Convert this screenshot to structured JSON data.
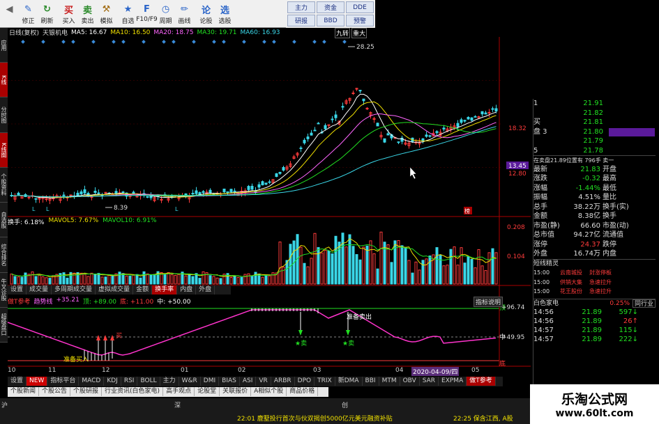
{
  "toolbar": {
    "buttons": [
      {
        "label": "",
        "icon": "back-icon"
      },
      {
        "label": "修正",
        "icon": "edit-icon"
      },
      {
        "label": "刷新",
        "icon": "refresh-icon"
      },
      {
        "label": "买入",
        "icon": "buy-icon"
      },
      {
        "label": "卖出",
        "icon": "sell-icon"
      },
      {
        "label": "模拟",
        "icon": "hammer-icon"
      },
      {
        "label": "自选",
        "icon": "star-icon"
      },
      {
        "label": "F10/F9",
        "icon": "f10-icon"
      },
      {
        "label": "周期",
        "icon": "clock-icon"
      },
      {
        "label": "画线",
        "icon": "pen-icon"
      },
      {
        "label": "论股",
        "icon": "chat-icon"
      },
      {
        "label": "选股",
        "icon": "filter-icon"
      }
    ],
    "quick": [
      "主力",
      "资金",
      "DDE",
      "研报",
      "BBD",
      "预警"
    ]
  },
  "left_tabs": [
    "应用",
    "K线",
    "分时图",
    "K线图",
    "个股资料",
    "自选股",
    "综合排名",
    "牛叉诊股",
    "超级盘口"
  ],
  "chart_header": {
    "title": "日线(复权)",
    "name": "天银机电",
    "ma": [
      {
        "label": "MA5: 16.67",
        "color": "#ffffff"
      },
      {
        "label": "MA10: 16.50",
        "color": "#f0e000"
      },
      {
        "label": "MA20: 18.75",
        "color": "#ff66ff"
      },
      {
        "label": "MA30: 19.71",
        "color": "#22e022"
      },
      {
        "label": "MA60: 16.93",
        "color": "#3ad7e8"
      }
    ],
    "tags": [
      "九转",
      "重大"
    ]
  },
  "price_labels": {
    "high": "28.25",
    "low": "8.39",
    "axis_1": "18.32",
    "axis_2": "13.45",
    "axis_3": "12.80",
    "marker": "榜"
  },
  "volume_header": [
    {
      "label": "换手: 6.18%",
      "color": "#ffffff"
    },
    {
      "label": "MAVOL5: 7.67%",
      "color": "#f0e000"
    },
    {
      "label": "MAVOL10: 6.91%",
      "color": "#22e022"
    }
  ],
  "volume_axis": [
    "0.208",
    "0.104"
  ],
  "mid_tabs": [
    "设置",
    "成交量",
    "多周期成交量",
    "虚拟成交量",
    "金额",
    "换手率",
    "内盘",
    "外盘"
  ],
  "mid_tabs_active": 5,
  "indicator": {
    "header": [
      {
        "label": "做T参考",
        "color": "#ff3b3b"
      },
      {
        "label": "趋势线",
        "color": "#ff66ff"
      },
      {
        "label": "+35.21",
        "color": "#ff66ff"
      },
      {
        "label": "顶: +89.00",
        "color": "#22e022"
      },
      {
        "label": "底: +11.00",
        "color": "#ff3b3b"
      },
      {
        "label": "中: +50.00",
        "color": "#ffffff"
      }
    ],
    "btn": "指标说明",
    "axis": [
      "+96.74",
      "+49.95"
    ],
    "labels": {
      "top": "顶",
      "mid": "中",
      "bot": "底",
      "buy": "买",
      "sell": "★卖",
      "sell2": "★卖",
      "sell_note": "准备卖出",
      "buy_note": "准备买入"
    }
  },
  "date_axis": [
    "10",
    "11",
    "12",
    "01",
    "02",
    "03",
    "04",
    "05"
  ],
  "date_box": "2020-04-09/四",
  "bottom_tabs": [
    "设置",
    "NEW",
    "指标平台",
    "MACD",
    "KDJ",
    "RSI",
    "BOLL",
    "主力",
    "W&R",
    "DMI",
    "BIAS",
    "ASI",
    "VR",
    "ARBR",
    "DPO",
    "TRIX",
    "新DMA",
    "BBI",
    "MTM",
    "OBV",
    "SAR",
    "EXPMA",
    "做T参考"
  ],
  "bottom_tabs2": [
    "个股新闻",
    "个股公告",
    "个股研报",
    "行业资讯(白色家电)",
    "高手观点",
    "论股堂",
    "关联报价",
    "A相似个股",
    "商品价格"
  ],
  "status": {
    "left": "沪",
    "mid1": "深",
    "mid2": "创",
    "ticker1": "22:01 鹿墅投行首次与伙双揭创5000亿元美元融资补贴",
    "ticker2": "22:25 保含江西, A股"
  },
  "order_book": {
    "sell": [
      {
        "n": "1",
        "price": "21.91",
        "vol": ""
      },
      {
        "n": "",
        "price": "21.82",
        "vol": ""
      },
      {
        "n": "买",
        "price": "21.81",
        "vol": ""
      },
      {
        "n": "盘 3",
        "price": "21.80",
        "vol": ""
      },
      {
        "n": "",
        "price": "21.79",
        "vol": ""
      },
      {
        "n": "5",
        "price": "21.78",
        "vol": ""
      }
    ],
    "summary": "在卖盘21.89位置有 796手 卖一",
    "stats": [
      [
        "最新",
        "21.83",
        "开盘",
        ""
      ],
      [
        "涨跌",
        "-0.32",
        "最高",
        ""
      ],
      [
        "涨幅",
        "-1.44%",
        "最低",
        ""
      ],
      [
        "振幅",
        "4.51%",
        "量比",
        ""
      ],
      [
        "总手",
        "38.22万",
        "换手(实)",
        ""
      ],
      [
        "金额",
        "8.38亿",
        "换手",
        ""
      ],
      [
        "市盈(静)",
        "66.60",
        "市盈(动)",
        ""
      ],
      [
        "总市值",
        "94.27亿",
        "流通值",
        ""
      ],
      [
        "涨停",
        "24.37",
        "跌停",
        ""
      ],
      [
        "外盘",
        "16.74万",
        "内盘",
        ""
      ]
    ],
    "alert_title": "短线精灵",
    "alerts": [
      [
        "15:00",
        "云南城投",
        "封涨停板"
      ],
      [
        "15:00",
        "供销大集",
        "急速拉升"
      ],
      [
        "15:00",
        "花王股份",
        "急速拉升"
      ]
    ],
    "sector": {
      "name": "白色家电",
      "pct": "0.25%",
      "btn": "同行业"
    },
    "ticks": [
      [
        "14:56",
        "21.89",
        "597",
        "green"
      ],
      [
        "14:56",
        "21.89",
        "26",
        "red"
      ],
      [
        "14:57",
        "21.89",
        "115",
        "green"
      ],
      [
        "14:57",
        "21.89",
        "222",
        "green"
      ]
    ]
  },
  "watermark": {
    "title": "乐淘公式网",
    "url": "www.60lt.com"
  }
}
